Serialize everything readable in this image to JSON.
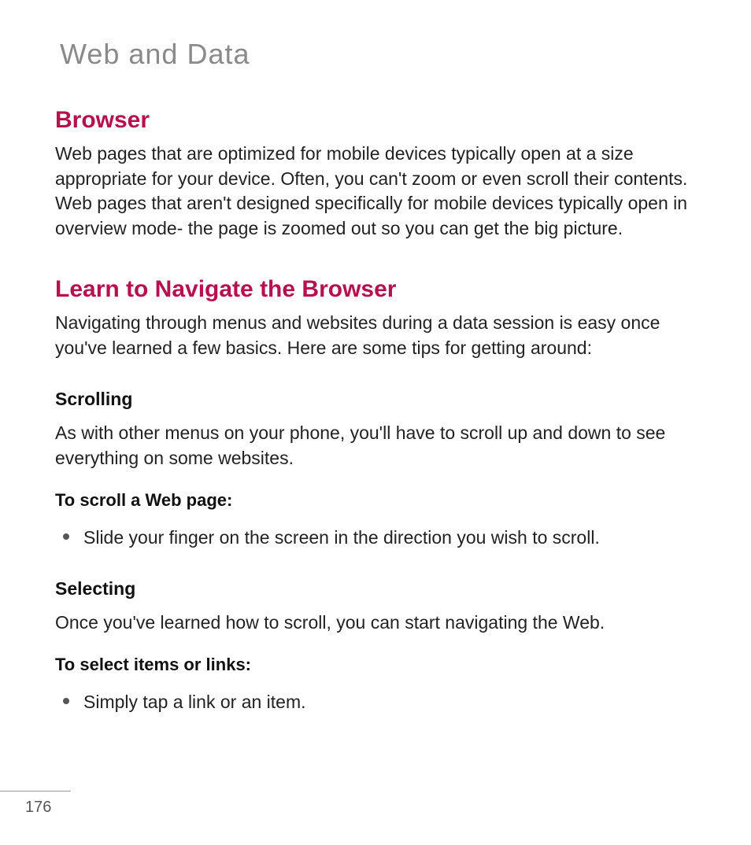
{
  "chapter_title": "Web and Data",
  "sections": {
    "browser": {
      "title": "Browser",
      "body": "Web pages that are optimized for mobile devices typically open at a size appropriate for your device. Often, you can't zoom or even scroll their contents. Web pages that aren't designed specifically for mobile devices typically open in overview mode- the page is zoomed out so you can get the big picture."
    },
    "navigate": {
      "title": "Learn to Navigate the Browser",
      "body": "Navigating through menus and websites during a data session is easy once you've learned a few basics. Here are some tips for getting around:",
      "scrolling": {
        "heading": "Scrolling",
        "body": "As with other menus on your phone, you'll have to scroll up and down to see everything on some websites.",
        "instruction_label": "To scroll a Web page:",
        "bullets": [
          "Slide your finger on the screen in the direction you wish to scroll."
        ]
      },
      "selecting": {
        "heading": "Selecting",
        "body": "Once you've learned how to scroll, you can start navigating the Web.",
        "instruction_label": "To select items or links:",
        "bullets": [
          "Simply tap a link or an item."
        ]
      }
    }
  },
  "page_number": "176"
}
